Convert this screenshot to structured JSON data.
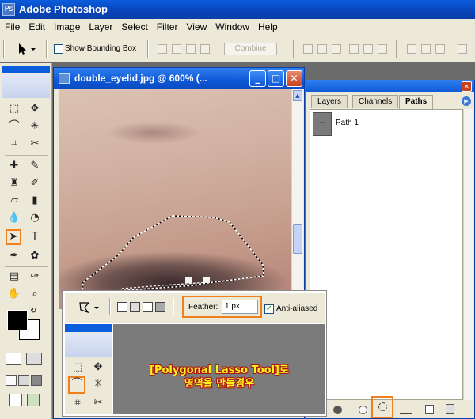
{
  "app": {
    "title": "Adobe Photoshop"
  },
  "menu": [
    "File",
    "Edit",
    "Image",
    "Layer",
    "Select",
    "Filter",
    "View",
    "Window",
    "Help"
  ],
  "options_bar": {
    "show_bounding_box": "Show Bounding Box",
    "show_bounding_box_checked": false,
    "combine_label": "Combine"
  },
  "document": {
    "title": "double_eyelid.jpg @ 600% (..."
  },
  "panel": {
    "tabs": [
      "Layers",
      "Channels",
      "Paths"
    ],
    "active_tab": "Paths",
    "paths": [
      {
        "name": "Path 1",
        "thumb": "--"
      }
    ]
  },
  "inset": {
    "feather_label": "Feather:",
    "feather_value": "1 px",
    "anti_aliased_label": "Anti-aliased",
    "anti_aliased_checked": true,
    "caption_line1": "[Polygonal Lasso Tool]로",
    "caption_line2": "영역을 만들경우"
  },
  "colors": {
    "highlight": "#f07f1d",
    "caption": "#fbf31d",
    "xp_blue": "#0a5ddd"
  }
}
